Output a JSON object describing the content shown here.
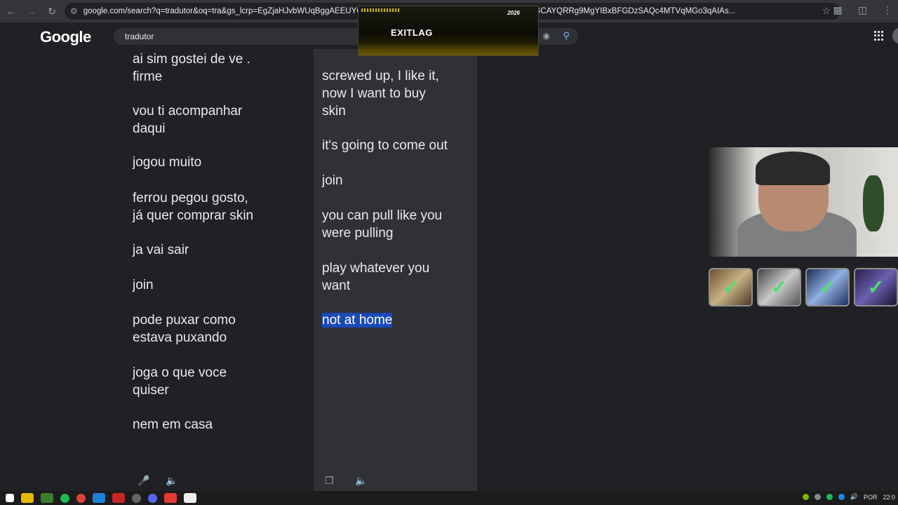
{
  "browser": {
    "url": "google.com/search?q=tradutor&oq=tra&gs_lcrp=EgZjaHJvbWUqBggAEEUYOzIGCAEQRRg5MgYIBBBFGD0yBggFEEUYPDIGCAYQRRg9MgYIBxBFGDzSAQc4MTVqMGo3qAIAs..."
  },
  "google": {
    "logo": "Google",
    "query": "tradutor"
  },
  "overlay": {
    "brand": "EXITLAG",
    "year": "2026"
  },
  "source_lines": [
    "ai sim gostei de ve .\nfirme",
    "vou ti acompanhar\ndaqui",
    "jogou muito",
    "ferrou pegou gosto,\njá quer comprar skin",
    "ja vai sair",
    "join",
    "pode puxar como\nestava puxando",
    "joga o que voce\nquiser",
    "nem em casa"
  ],
  "target_lines": [
    "screwed up, I like it,\nnow I want to buy\nskin",
    "it's going to come out",
    "join",
    "you can pull like you\nwere pulling",
    "play whatever you\nwant",
    "not at home"
  ],
  "tray": {
    "lang": "POR",
    "time": "22:0"
  }
}
